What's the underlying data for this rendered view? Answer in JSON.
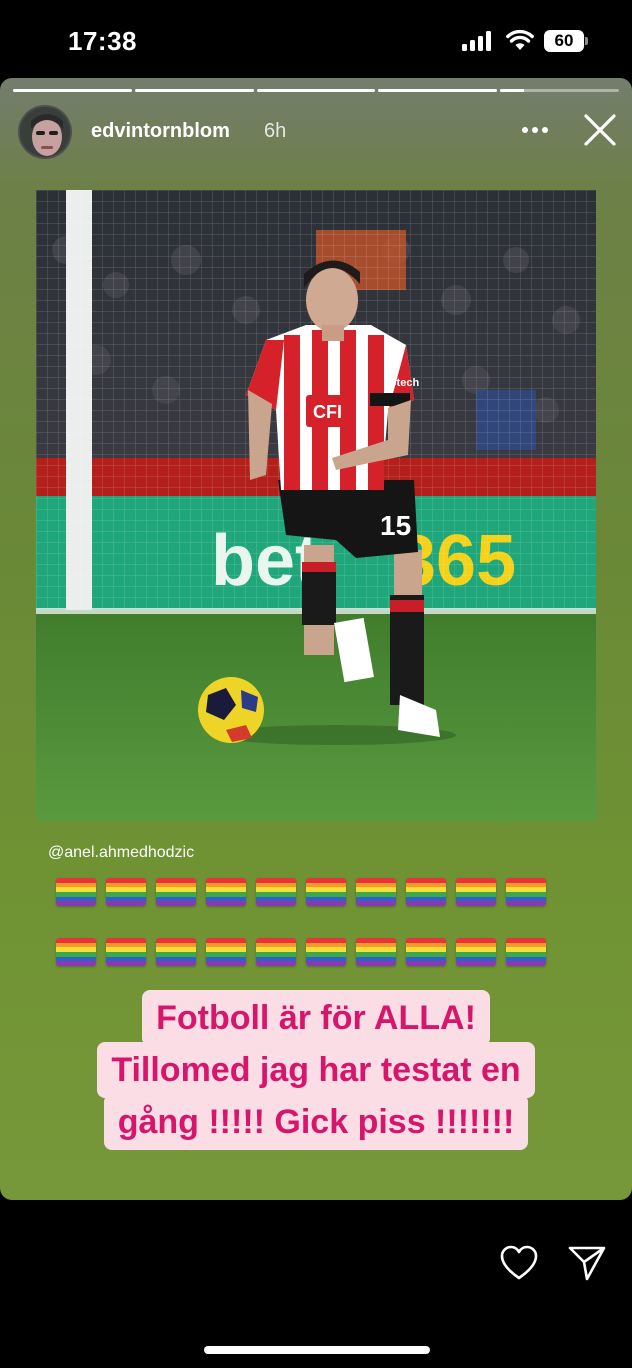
{
  "status_bar": {
    "time": "17:38",
    "battery": "60",
    "icons": [
      "signal-icon",
      "wifi-icon",
      "battery-icon"
    ]
  },
  "story": {
    "progress": [
      1,
      1,
      1,
      1,
      0.2
    ],
    "username": "edvintornblom",
    "time_ago": "6h",
    "mention": "@anel.ahmedhodzic",
    "flag_rows": [
      10,
      10
    ],
    "caption_lines": [
      "Fotboll är för ALLA!",
      "Tillomed jag har testat en",
      "gång !!!!! Gick piss !!!!!!!"
    ],
    "photo": {
      "shirt_text": "CFI",
      "shirt_brand": "Gtech",
      "shirt_number": "15",
      "board_text": "bet365"
    }
  },
  "colors": {
    "caption_text": "#d6156b",
    "caption_bg": "#fbdde6",
    "background_top": "#737d6d",
    "background_bottom": "#77983a"
  },
  "icons": [
    "more-icon",
    "close-icon",
    "heart-icon",
    "send-icon"
  ]
}
